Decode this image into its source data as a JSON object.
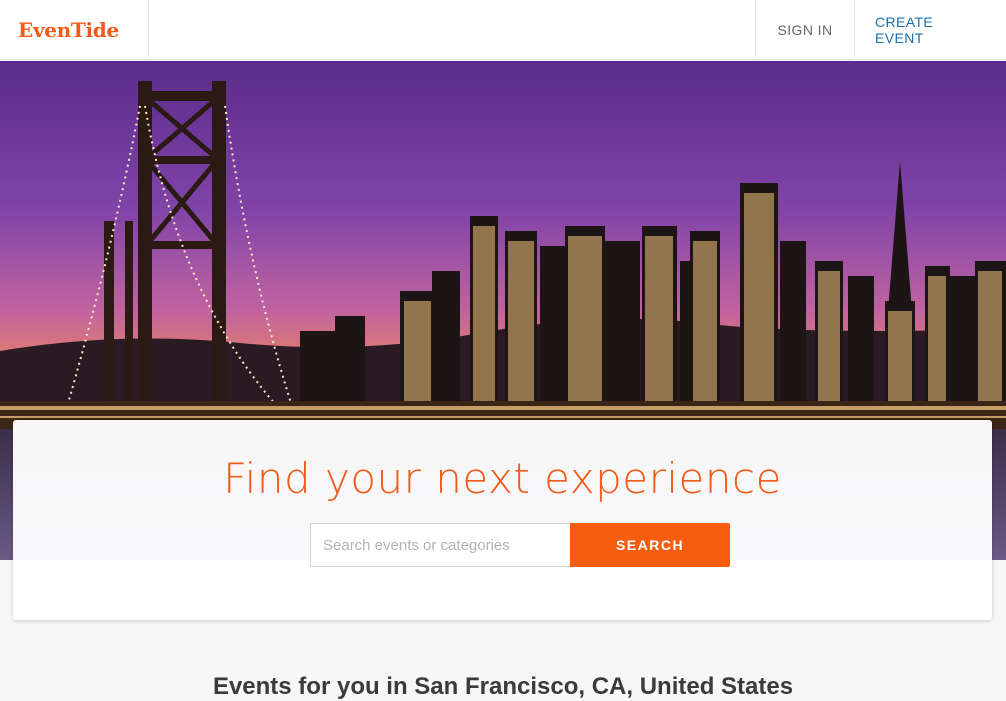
{
  "brand": {
    "name": "EvenTide",
    "color": "#f05a1a"
  },
  "nav": {
    "sign_in": "SIGN IN",
    "create_event": "CREATE EVENT",
    "create_event_color": "#1a6fb0"
  },
  "hero": {
    "image": "san-francisco-bay-bridge-skyline-at-sunset",
    "headline": "Find your next experience",
    "headline_color": "#f05a1a"
  },
  "search": {
    "placeholder": "Search events or categories",
    "value": "",
    "button_label": "SEARCH",
    "button_color": "#f75d0f"
  },
  "events_section": {
    "heading": "Events for you in San Francisco, CA, United States"
  }
}
